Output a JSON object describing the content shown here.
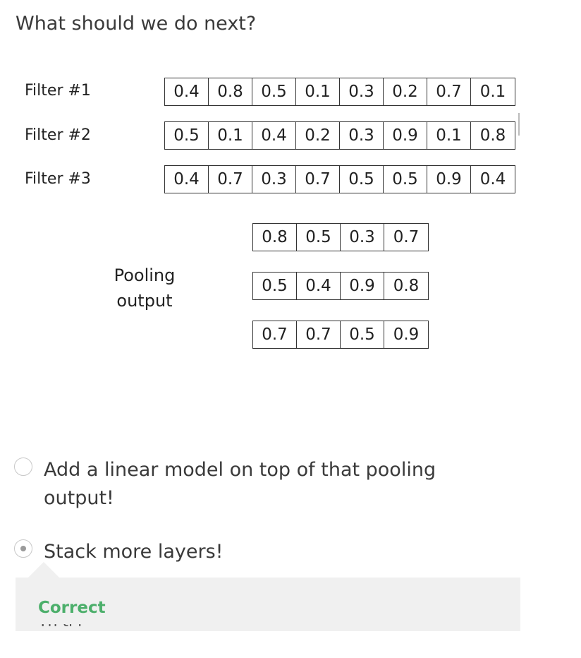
{
  "question": "What should we do next?",
  "filters": [
    {
      "label": "Filter #1",
      "values": [
        "0.4",
        "0.8",
        "0.5",
        "0.1",
        "0.3",
        "0.2",
        "0.7",
        "0.1"
      ]
    },
    {
      "label": "Filter #2",
      "values": [
        "0.5",
        "0.1",
        "0.4",
        "0.2",
        "0.3",
        "0.9",
        "0.1",
        "0.8"
      ]
    },
    {
      "label": "Filter #3",
      "values": [
        "0.4",
        "0.7",
        "0.3",
        "0.7",
        "0.5",
        "0.5",
        "0.9",
        "0.4"
      ]
    }
  ],
  "pooling": {
    "label_line1": "Pooling",
    "label_line2": "output",
    "rows": [
      [
        "0.8",
        "0.5",
        "0.3",
        "0.7"
      ],
      [
        "0.5",
        "0.4",
        "0.9",
        "0.8"
      ],
      [
        "0.7",
        "0.7",
        "0.5",
        "0.9"
      ]
    ]
  },
  "options": [
    {
      "text": "Add a linear model on top of that pooling output!",
      "selected": false
    },
    {
      "text": "Stack more layers!",
      "selected": true
    }
  ],
  "feedback": {
    "status": "Correct",
    "status_color": "#4caf6b",
    "clipped_text": "Th    ti l"
  }
}
